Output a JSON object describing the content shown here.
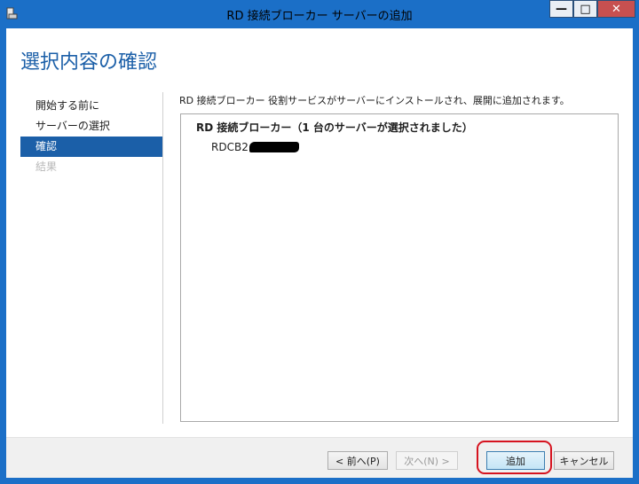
{
  "window": {
    "title": "RD 接続ブローカー サーバーの追加",
    "minimize_glyph": "—",
    "maximize_glyph": "□",
    "close_glyph": "✕"
  },
  "page": {
    "title": "選択内容の確認",
    "description": "RD 接続ブローカー 役割サービスがサーバーにインストールされ、展開に追加されます。"
  },
  "nav": {
    "items": [
      {
        "label": "開始する前に",
        "state": "normal"
      },
      {
        "label": "サーバーの選択",
        "state": "normal"
      },
      {
        "label": "確認",
        "state": "active"
      },
      {
        "label": "結果",
        "state": "disabled"
      }
    ]
  },
  "summary": {
    "role_heading": "RD 接続ブローカー（1 台のサーバーが選択されました）",
    "server_name_prefix": "RDCB2"
  },
  "footer": {
    "prev_label": "< 前へ(P)",
    "next_label": "次へ(N) >",
    "install_label": "追加",
    "cancel_label": "キャンセル"
  },
  "colors": {
    "titlebar": "#1b6fc7",
    "accent": "#1b5fa8",
    "highlight": "#d6131f"
  }
}
